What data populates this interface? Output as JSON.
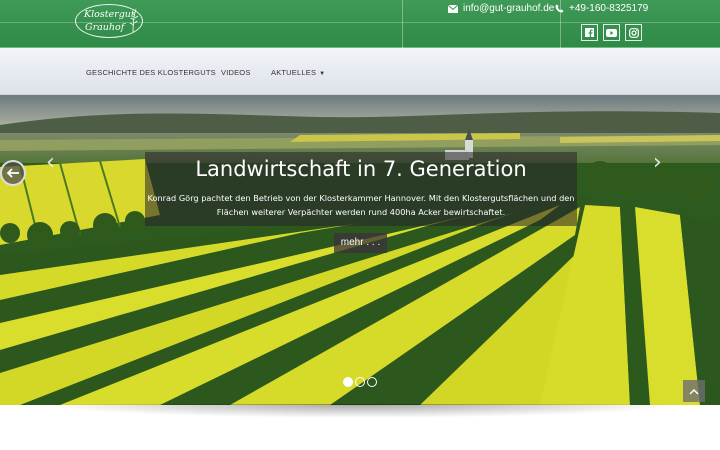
{
  "logo": {
    "line1": "Klostergut",
    "line2": "Grauhof"
  },
  "contact": {
    "email": "info@gut-grauhof.de",
    "phone": "+49-160-8325179"
  },
  "social": [
    "facebook-icon",
    "youtube-icon",
    "instagram-icon"
  ],
  "nav": {
    "items": [
      {
        "label": "GESCHICHTE DES KLOSTERGUTS"
      },
      {
        "label": "VIDEOS"
      },
      {
        "label": "AKTUELLES"
      }
    ]
  },
  "slider": {
    "title": "Landwirtschaft in 7. Generation",
    "text_line1": "Konrad Görg pachtet den Betrieb von der Klosterkammer Hannover. Mit den Klostergutsflächen und den",
    "text_line2": "Flächen weiterer Verpächter werden rund 400ha Acker bewirtschaftet.",
    "button": "mehr . . .",
    "dots": 3,
    "active_dot": 1
  },
  "colors": {
    "brand_green": "#3a9452",
    "field_yellow": "#d7dc2a",
    "field_green": "#2f5a20"
  }
}
